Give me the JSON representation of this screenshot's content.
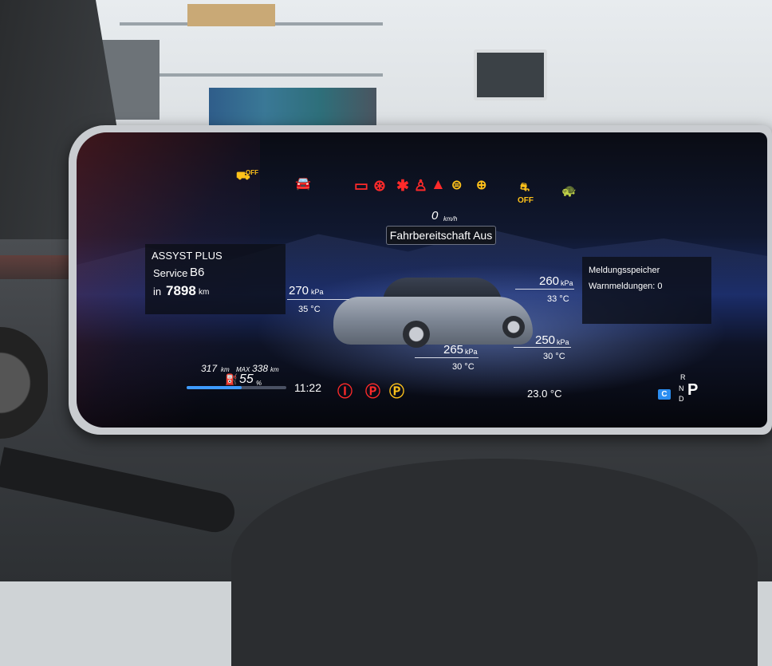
{
  "indicators_top": {
    "esp_off": "OFF",
    "hold_off": "OFF"
  },
  "status": {
    "speed_value": "0",
    "speed_unit": "km/h",
    "message": "Fahrbereitschaft Aus"
  },
  "service": {
    "title": "ASSYST PLUS",
    "service_label": "Service",
    "service_code": "B6",
    "in_label": "in",
    "distance": "7898",
    "distance_unit": "km"
  },
  "messages": {
    "title": "Meldungsspeicher",
    "warnings": "Warnmeldungen: 0"
  },
  "tires": {
    "front_left": {
      "pressure": "270",
      "temp": "35 °C"
    },
    "front_right": {
      "pressure": "260",
      "temp": "33 °C"
    },
    "rear_left": {
      "pressure": "265",
      "temp": "30 °C"
    },
    "rear_right": {
      "pressure": "250",
      "temp": "30 °C"
    },
    "unit": "kPa"
  },
  "battery": {
    "range": "317",
    "range_unit": "km",
    "max_label": "MAX",
    "max_range": "338",
    "max_unit": "km",
    "charge": "55",
    "charge_unit": "%",
    "charge_fraction": 0.55
  },
  "bottom": {
    "time": "11:22",
    "outside_temp": "23.0 °C",
    "drive_mode": "C",
    "gear_r": "R",
    "gear_n": "N",
    "gear_d": "D",
    "gear_p": "P"
  },
  "colors": {
    "warning_red": "#ff2a2a",
    "warning_amber": "#ffc21a",
    "accent_blue": "#3e9bff"
  }
}
